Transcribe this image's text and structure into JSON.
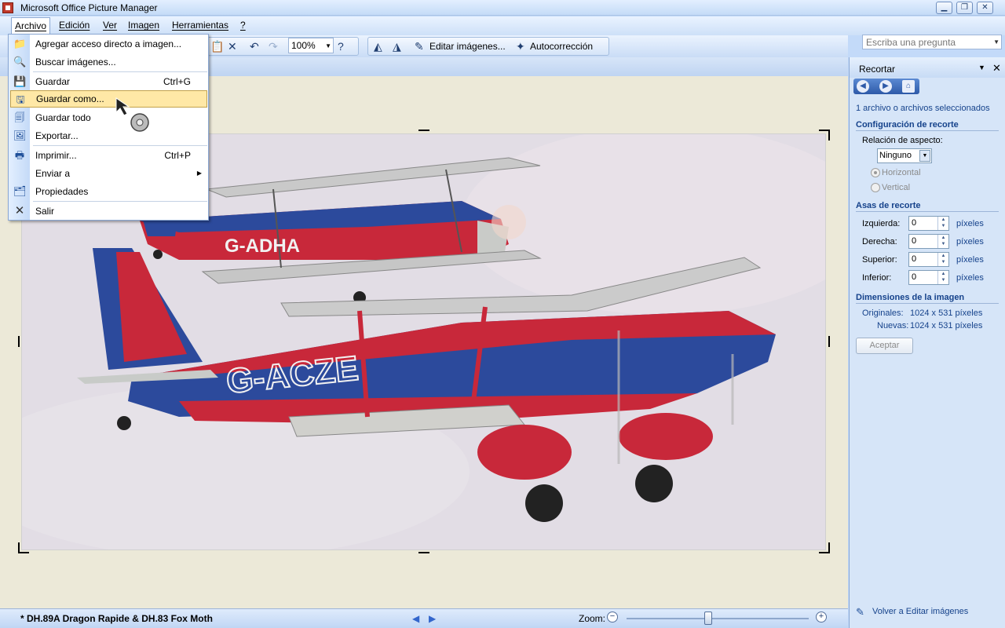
{
  "window": {
    "title": "Microsoft Office Picture Manager"
  },
  "menubar": {
    "items": [
      "Archivo",
      "Edición",
      "Ver",
      "Imagen",
      "Herramientas",
      "?"
    ],
    "ask_placeholder": "Escriba una pregunta"
  },
  "toolbar": {
    "zoom_value": "100%",
    "edit_images_label": "Editar imágenes...",
    "autocorrect_label": "Autocorrección"
  },
  "file_menu": {
    "items": [
      {
        "label": "Agregar acceso directo a imagen...",
        "shortcut": "",
        "icon": "add-shortcut-icon"
      },
      {
        "label": "Buscar imágenes...",
        "shortcut": "",
        "icon": "find-images-icon"
      },
      {
        "label": "Guardar",
        "shortcut": "Ctrl+G",
        "icon": "save-icon"
      },
      {
        "label": "Guardar como...",
        "shortcut": "",
        "icon": "save-as-icon",
        "highlighted": true
      },
      {
        "label": "Guardar todo",
        "shortcut": "",
        "icon": "save-all-icon"
      },
      {
        "label": "Exportar...",
        "shortcut": "",
        "icon": "export-icon"
      },
      {
        "label": "Imprimir...",
        "shortcut": "Ctrl+P",
        "icon": "print-icon"
      },
      {
        "label": "Enviar a",
        "shortcut": "",
        "icon": "",
        "submenu": true
      },
      {
        "label": "Propiedades",
        "shortcut": "",
        "icon": "properties-icon"
      },
      {
        "label": "Salir",
        "shortcut": "",
        "icon": "close-icon"
      }
    ]
  },
  "status": {
    "filename": "* DH.89A Dragon Rapide & DH.83 Fox Moth",
    "zoom_label": "Zoom:",
    "zoom_level": 0.45
  },
  "taskpane": {
    "title": "Recortar",
    "selection_text": "1 archivo o archivos seleccionados",
    "crop_settings_heading": "Configuración de recorte",
    "aspect_label": "Relación de aspecto:",
    "aspect_value": "Ninguno",
    "orientation_horizontal": "Horizontal",
    "orientation_vertical": "Vertical",
    "handles_heading": "Asas de recorte",
    "handles": [
      {
        "label": "Izquierda:",
        "value": "0",
        "unit": "píxeles"
      },
      {
        "label": "Derecha:",
        "value": "0",
        "unit": "píxeles"
      },
      {
        "label": "Superior:",
        "value": "0",
        "unit": "píxeles"
      },
      {
        "label": "Inferior:",
        "value": "0",
        "unit": "píxeles"
      }
    ],
    "dimensions_heading": "Dimensiones de la imagen",
    "original_label": "Originales:",
    "original_value": "1024 x 531 píxeles",
    "new_label": "Nuevas:",
    "new_value": "1024 x 531 píxeles",
    "accept_label": "Aceptar",
    "back_link": "Volver a Editar imágenes"
  },
  "photo": {
    "plane_top_registration": "G-ADHA",
    "plane_bottom_registration": "G-ACZE"
  }
}
